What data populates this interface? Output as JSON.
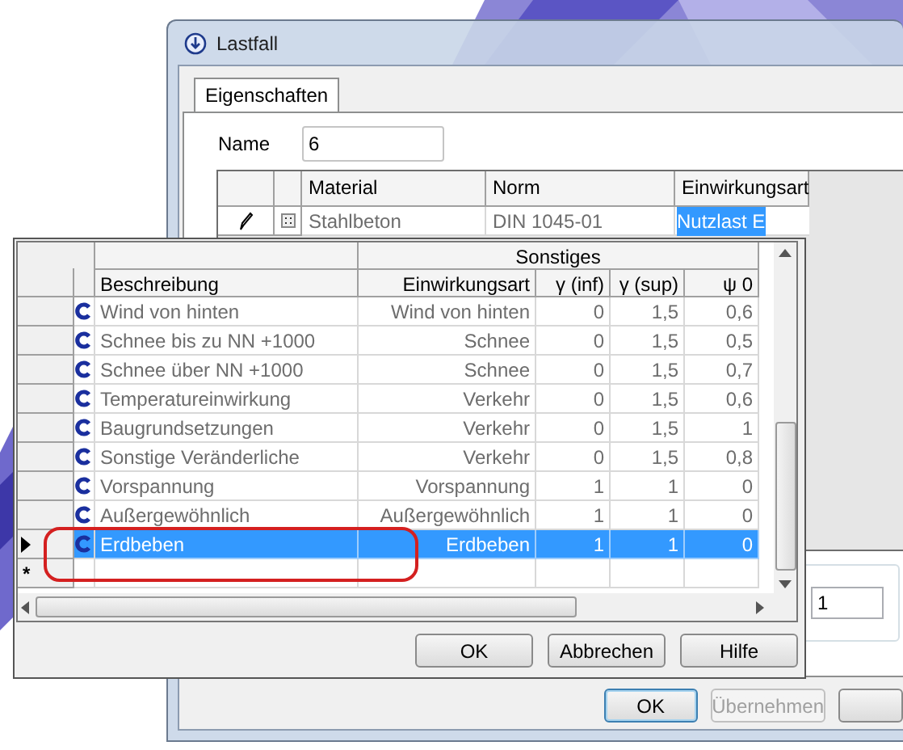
{
  "window": {
    "title": "Lastfall"
  },
  "tabs": [
    {
      "label": "Eigenschaften",
      "selected": true
    }
  ],
  "name_field": {
    "label": "Name",
    "value": "6"
  },
  "material_grid": {
    "columns": [
      "Material",
      "Norm",
      "Einwirkungsart"
    ],
    "rows": [
      {
        "material": "Stahlbeton",
        "norm": "DIN 1045-01",
        "einwirkungsart": "Nutzlast E",
        "selected": true
      }
    ]
  },
  "side_field": {
    "value": "1"
  },
  "window_buttons": [
    {
      "label": "OK",
      "default": true,
      "disabled": false
    },
    {
      "label": "Übernehmen",
      "default": false,
      "disabled": true
    }
  ],
  "popup": {
    "group_header": "Sonstiges",
    "columns": [
      "Beschreibung",
      "Einwirkungsart",
      "γ (inf)",
      "γ (sup)",
      "ψ 0"
    ],
    "rows": [
      {
        "beschreibung": "Wind von hinten",
        "einwirkungsart": "Wind von hinten",
        "gamma_inf": "0",
        "gamma_sup": "1,5",
        "psi_0": "0,6",
        "selected": false
      },
      {
        "beschreibung": "Schnee bis zu NN +1000",
        "einwirkungsart": "Schnee",
        "gamma_inf": "0",
        "gamma_sup": "1,5",
        "psi_0": "0,5",
        "selected": false
      },
      {
        "beschreibung": "Schnee über NN +1000",
        "einwirkungsart": "Schnee",
        "gamma_inf": "0",
        "gamma_sup": "1,5",
        "psi_0": "0,7",
        "selected": false
      },
      {
        "beschreibung": "Temperatureinwirkung",
        "einwirkungsart": "Verkehr",
        "gamma_inf": "0",
        "gamma_sup": "1,5",
        "psi_0": "0,6",
        "selected": false
      },
      {
        "beschreibung": "Baugrundsetzungen",
        "einwirkungsart": "Verkehr",
        "gamma_inf": "0",
        "gamma_sup": "1,5",
        "psi_0": "1",
        "selected": false
      },
      {
        "beschreibung": "Sonstige Veränderliche",
        "einwirkungsart": "Verkehr",
        "gamma_inf": "0",
        "gamma_sup": "1,5",
        "psi_0": "0,8",
        "selected": false
      },
      {
        "beschreibung": "Vorspannung",
        "einwirkungsart": "Vorspannung",
        "gamma_inf": "1",
        "gamma_sup": "1",
        "psi_0": "0",
        "selected": false
      },
      {
        "beschreibung": "Außergewöhnlich",
        "einwirkungsart": "Außergewöhnlich",
        "gamma_inf": "1",
        "gamma_sup": "1",
        "psi_0": "0",
        "selected": false
      },
      {
        "beschreibung": "Erdbeben",
        "einwirkungsart": "Erdbeben",
        "gamma_inf": "1",
        "gamma_sup": "1",
        "psi_0": "0",
        "selected": true
      }
    ],
    "new_row_marker": "*",
    "buttons": [
      "OK",
      "Abbrechen",
      "Hilfe"
    ]
  }
}
